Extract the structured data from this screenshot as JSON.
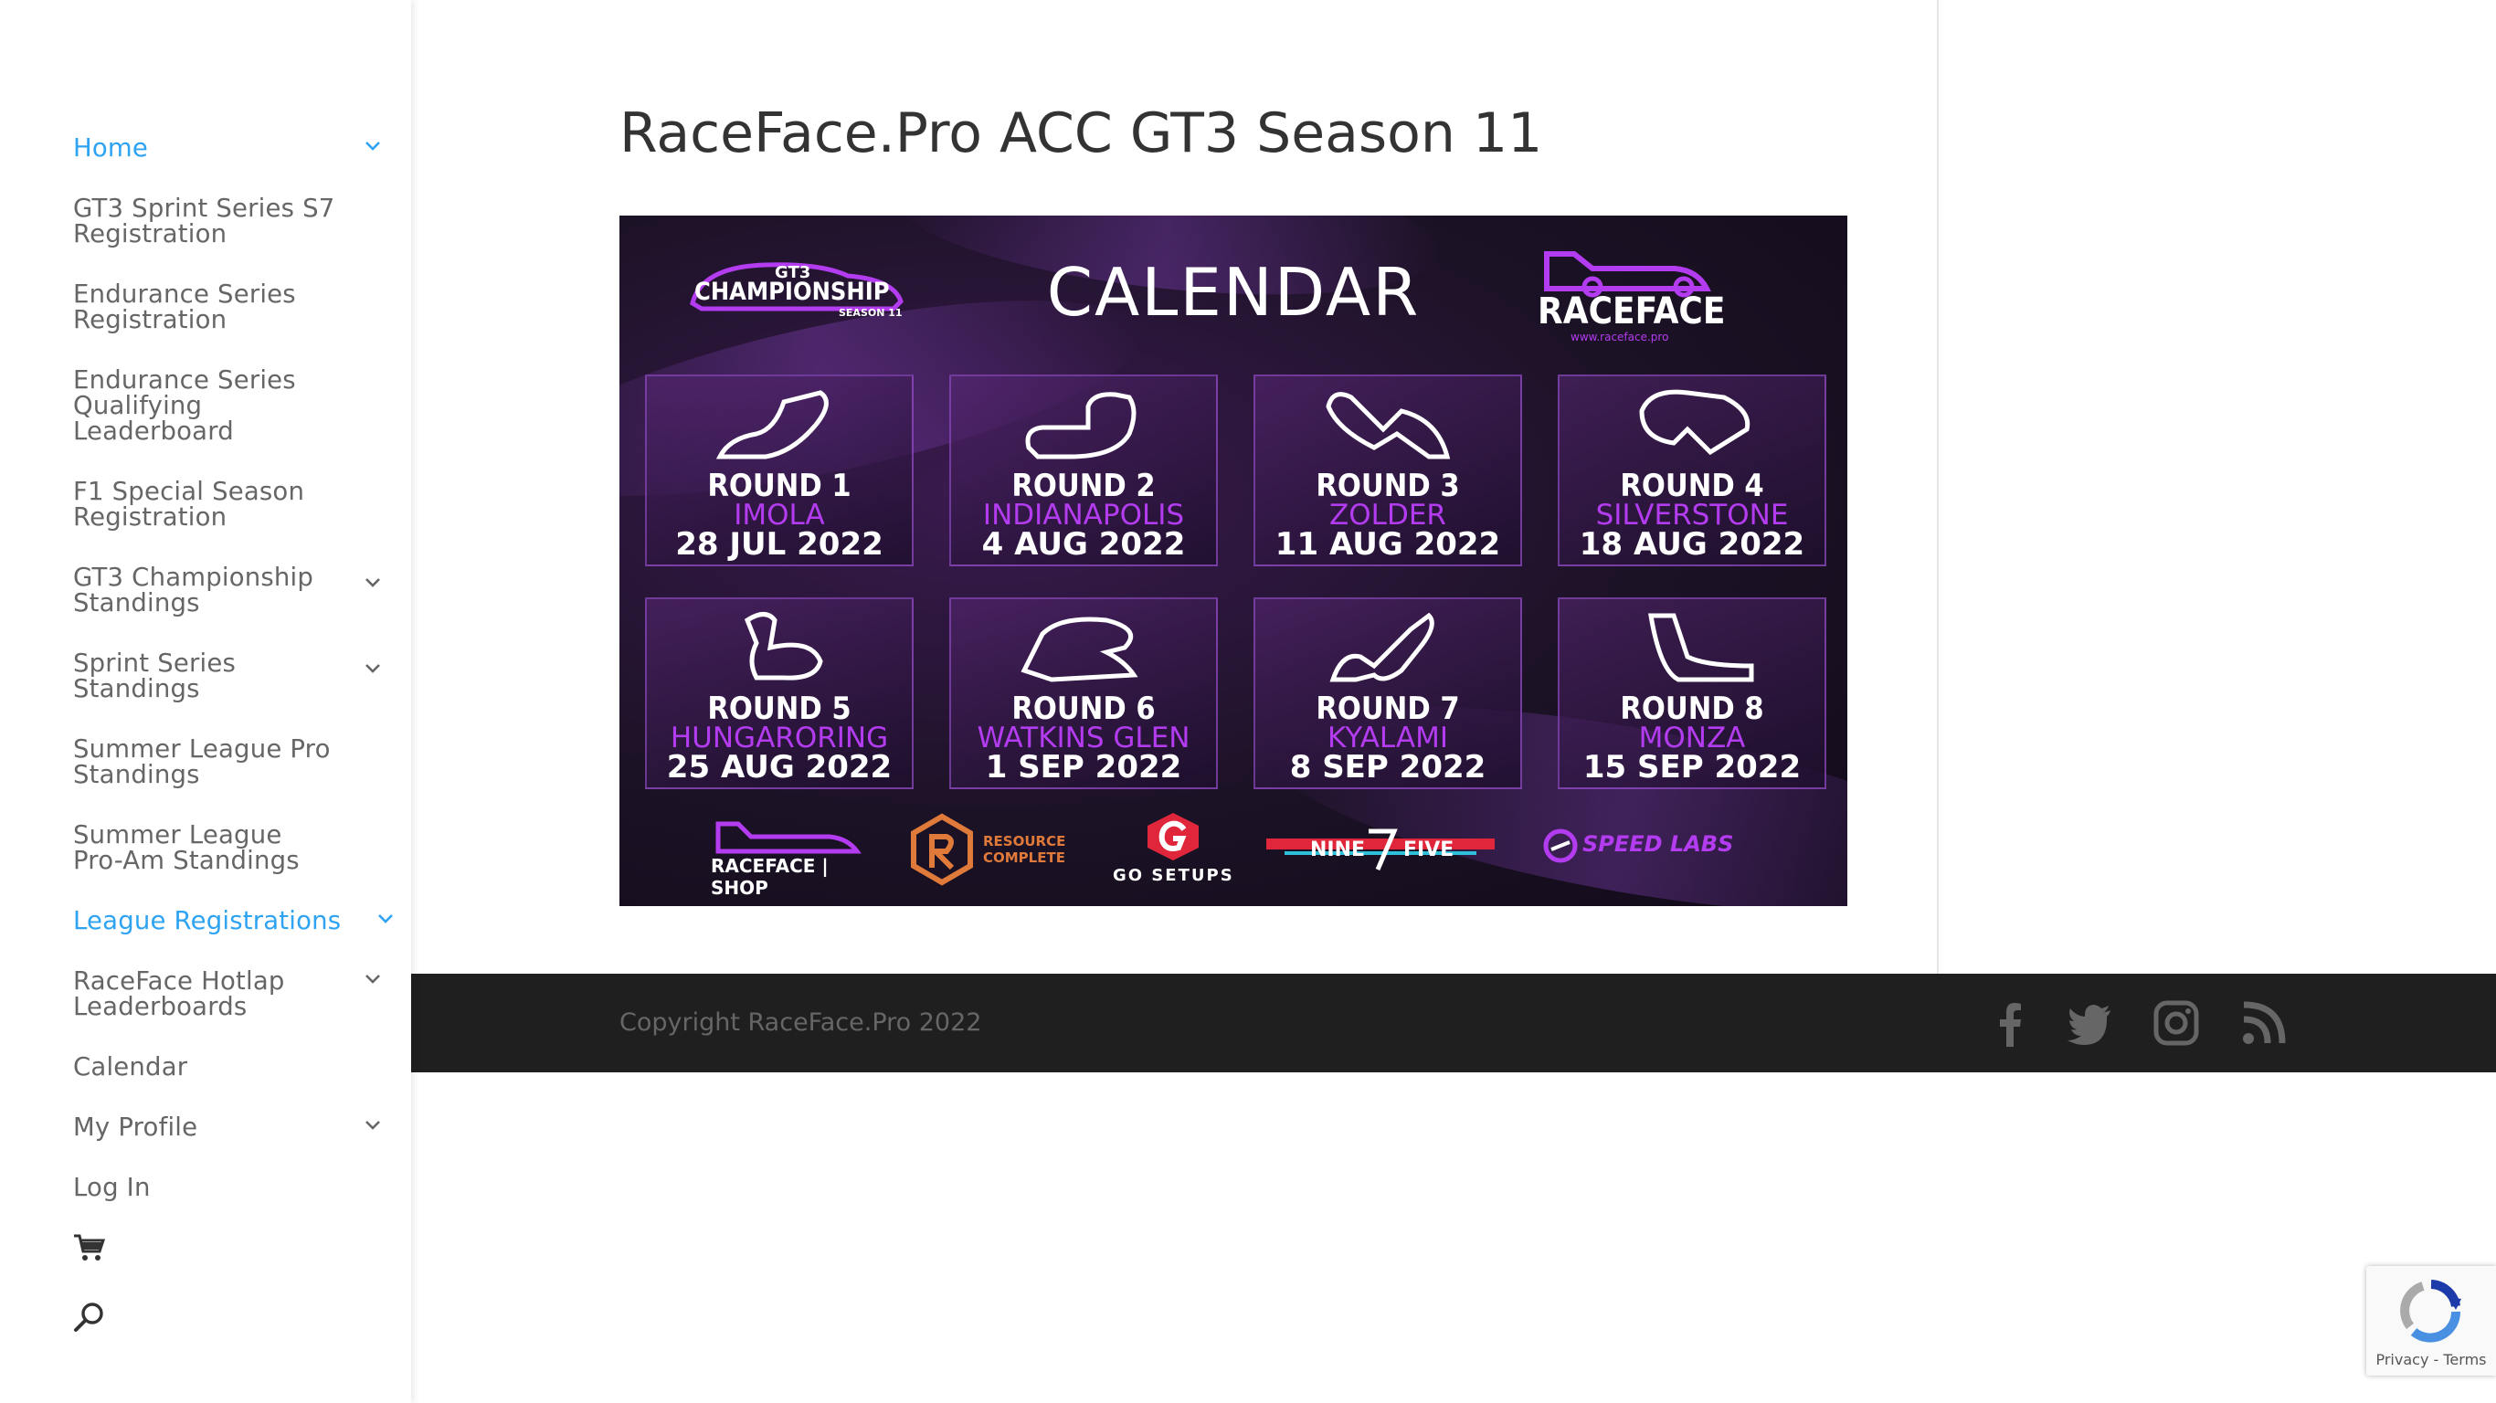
{
  "sidebar": {
    "items": [
      {
        "label": "Home",
        "has_submenu": true,
        "active": true
      },
      {
        "label": "GT3 Sprint Series S7 Registration",
        "has_submenu": false
      },
      {
        "label": "Endurance Series Registration",
        "has_submenu": false
      },
      {
        "label": "Endurance Series Qualifying Leaderboard",
        "has_submenu": false
      },
      {
        "label": "F1 Special Season Registration",
        "has_submenu": false
      },
      {
        "label": "GT3 Championship Standings",
        "has_submenu": true
      },
      {
        "label": "Sprint Series Standings",
        "has_submenu": true
      },
      {
        "label": "Summer League Pro Standings",
        "has_submenu": false
      },
      {
        "label": "Summer League Pro-Am Standings",
        "has_submenu": false
      },
      {
        "label": "League Registrations",
        "has_submenu": true,
        "active": true
      },
      {
        "label": "RaceFace Hotlap Leaderboards",
        "has_submenu": true
      },
      {
        "label": "Calendar",
        "has_submenu": false
      },
      {
        "label": "My Profile",
        "has_submenu": true
      },
      {
        "label": "Log In",
        "has_submenu": false
      }
    ],
    "cart_icon": "shopping-cart-icon",
    "search_icon": "search-icon"
  },
  "main": {
    "title": "RaceFace.Pro ACC GT3 Season 11",
    "calendar_image": {
      "heading": "CALENDAR",
      "left_logo": {
        "top": "GT3",
        "main": "CHAMPIONSHIP",
        "sub": "SEASON 11"
      },
      "right_logo": {
        "main": "RACEFACE",
        "url": "www.raceface.pro"
      },
      "rounds": [
        {
          "title": "ROUND 1",
          "venue": "IMOLA",
          "date": "28 JUL 2022"
        },
        {
          "title": "ROUND 2",
          "venue": "INDIANAPOLIS",
          "date": "4 AUG 2022"
        },
        {
          "title": "ROUND 3",
          "venue": "ZOLDER",
          "date": "11 AUG 2022"
        },
        {
          "title": "ROUND 4",
          "venue": "SILVERSTONE",
          "date": "18 AUG 2022"
        },
        {
          "title": "ROUND 5",
          "venue": "HUNGARORING",
          "date": "25 AUG 2022"
        },
        {
          "title": "ROUND 6",
          "venue": "WATKINS GLEN",
          "date": "1 SEP 2022"
        },
        {
          "title": "ROUND 7",
          "venue": "KYALAMI",
          "date": "8 SEP 2022"
        },
        {
          "title": "ROUND 8",
          "venue": "MONZA",
          "date": "15 SEP 2022"
        }
      ],
      "sponsors": {
        "raceface_shop": "RACEFACE | SHOP",
        "resource_line1": "RESOURCE",
        "resource_line2": "COMPLETE",
        "go_setups": "GO SETUPS",
        "nine": "NINE",
        "five": "FIVE",
        "speed_labs": "SPEED LABS"
      },
      "accent_color": "#b43cf0"
    }
  },
  "footer": {
    "copyright": "Copyright RaceFace.Pro 2022",
    "social_icons": [
      "facebook-icon",
      "twitter-icon",
      "instagram-icon",
      "rss-icon"
    ]
  },
  "recaptcha": {
    "privacy": "Privacy",
    "separator": " - ",
    "terms": "Terms"
  },
  "colors": {
    "link_active": "#2ea3f2",
    "nav_text": "#666666",
    "footer_bg": "#1f1f1f"
  }
}
